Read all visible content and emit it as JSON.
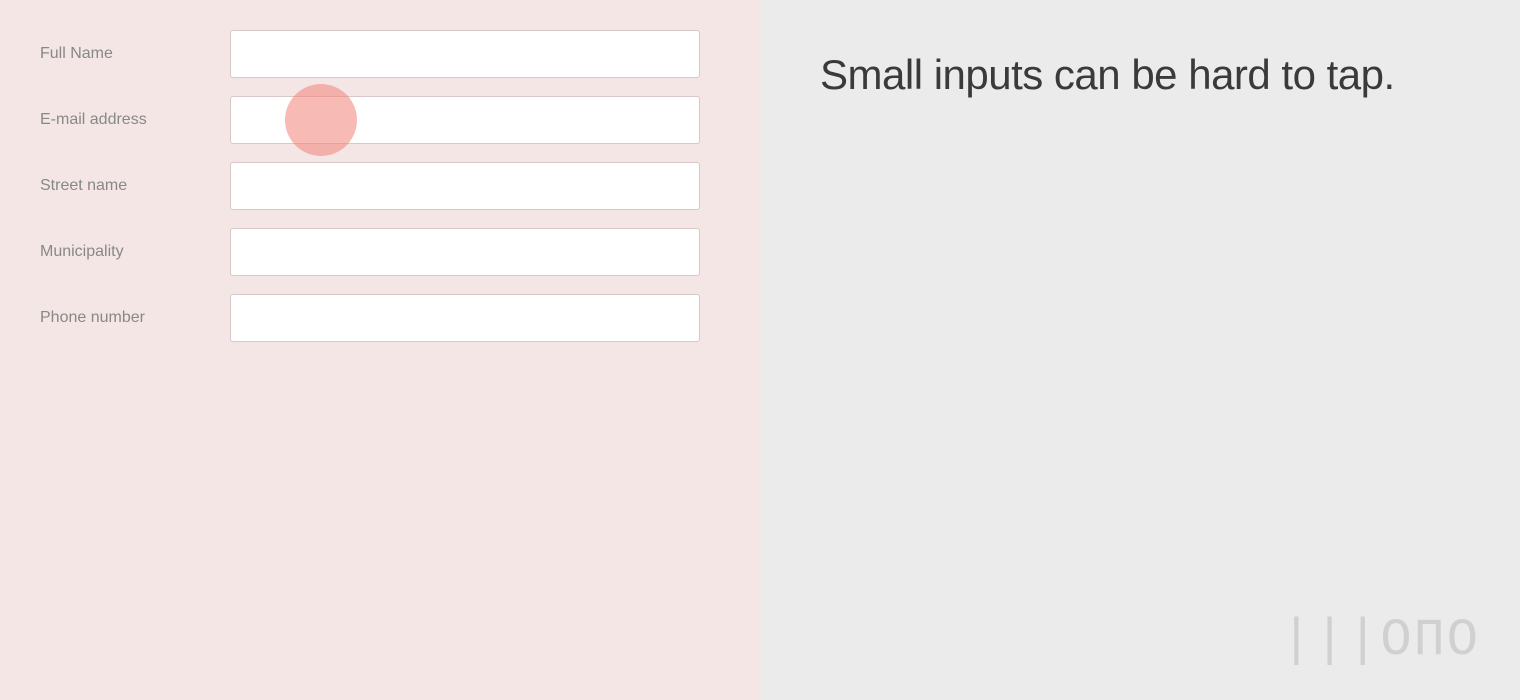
{
  "left_panel": {
    "background_color": "#f5e6e6"
  },
  "right_panel": {
    "background_color": "#ebebeb",
    "tagline": "Small inputs can be hard to tap.",
    "logo": "|||ОПО"
  },
  "form": {
    "fields": [
      {
        "id": "full-name",
        "label": "Full Name",
        "placeholder": "",
        "value": "",
        "type": "text"
      },
      {
        "id": "email-address",
        "label": "E-mail address",
        "placeholder": "",
        "value": "",
        "type": "email"
      },
      {
        "id": "street-name",
        "label": "Street name",
        "placeholder": "",
        "value": "",
        "type": "text"
      },
      {
        "id": "municipality",
        "label": "Municipality",
        "placeholder": "",
        "value": "",
        "type": "text"
      },
      {
        "id": "phone-number",
        "label": "Phone number",
        "placeholder": "",
        "value": "",
        "type": "tel"
      }
    ]
  }
}
